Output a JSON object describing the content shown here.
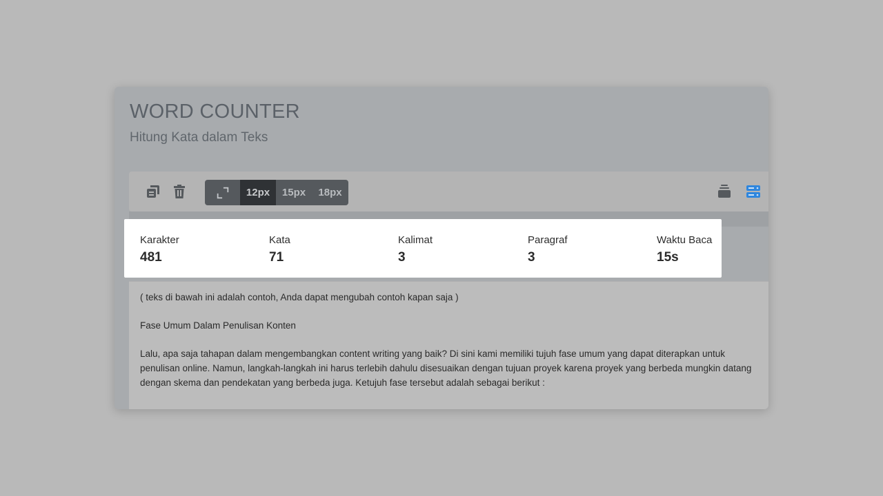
{
  "header": {
    "title": "WORD COUNTER",
    "subtitle": "Hitung Kata dalam Teks"
  },
  "toolbar": {
    "copy_icon": "copy-icon",
    "delete_icon": "trash-icon",
    "expand_icon": "expand-icon",
    "font_sizes": [
      "12px",
      "15px",
      "18px"
    ],
    "selected_font_size": "12px",
    "layout_icons": [
      "stack-icon",
      "server-icon"
    ],
    "accent_color": "#2e86de"
  },
  "stats": {
    "karakter": {
      "label": "Karakter",
      "value": "481"
    },
    "kata": {
      "label": "Kata",
      "value": "71"
    },
    "kalimat": {
      "label": "Kalimat",
      "value": "3"
    },
    "paragraf": {
      "label": "Paragraf",
      "value": "3"
    },
    "waktu_baca": {
      "label": "Waktu Baca",
      "value": "15s"
    }
  },
  "content": {
    "paragraphs": [
      "( teks di bawah ini adalah contoh, Anda dapat mengubah contoh kapan saja )",
      "Fase Umum Dalam Penulisan Konten",
      "Lalu, apa saja tahapan dalam mengembangkan content writing yang baik? Di sini kami memiliki tujuh fase umum yang dapat diterapkan untuk penulisan online. Namun, langkah-langkah ini harus terlebih dahulu disesuaikan dengan tujuan proyek karena proyek yang berbeda mungkin datang dengan skema dan pendekatan yang berbeda juga. Ketujuh fase tersebut adalah sebagai berikut :"
    ]
  }
}
